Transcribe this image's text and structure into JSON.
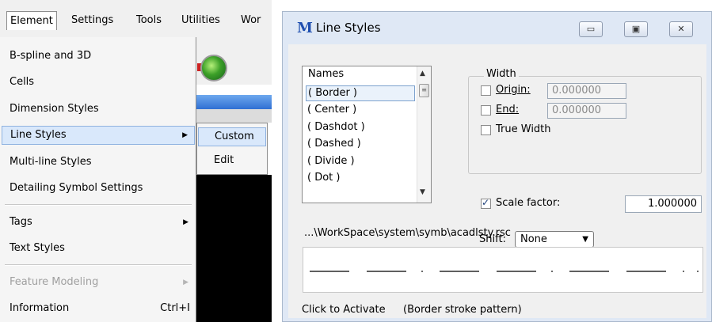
{
  "menubar": {
    "items": [
      {
        "label": "Element",
        "active": true
      },
      {
        "label": "Settings",
        "active": false
      },
      {
        "label": "Tools",
        "active": false
      },
      {
        "label": "Utilities",
        "active": false
      },
      {
        "label": "Wor",
        "active": false
      }
    ]
  },
  "element_menu": {
    "items": [
      {
        "label": "B-spline and 3D"
      },
      {
        "label": "Cells"
      },
      {
        "label": "Dimension Styles"
      },
      {
        "label": "Line Styles",
        "submenu": true,
        "highlighted": true
      },
      {
        "label": "Multi-line Styles"
      },
      {
        "label": "Detailing Symbol Settings"
      },
      {
        "label": "Tags",
        "submenu": true
      },
      {
        "label": "Text Styles"
      },
      {
        "label": "Feature Modeling",
        "submenu": true,
        "disabled": true
      },
      {
        "label": "Information",
        "shortcut": "Ctrl+I"
      }
    ]
  },
  "line_styles_submenu": {
    "items": [
      {
        "label": "Custom",
        "highlighted": true
      },
      {
        "label": "Edit"
      }
    ]
  },
  "dialog": {
    "title": "Line Styles",
    "window_buttons": {
      "minimize": "▭",
      "restore": "▣",
      "close": "✕"
    },
    "names_list": {
      "header": "Names",
      "items": [
        "( Border )",
        "( Center )",
        "( Dashdot )",
        "( Dashed )",
        "( Divide )",
        "( Dot )"
      ],
      "selected_index": 0
    },
    "width": {
      "legend": "Width",
      "origin_label": "Origin:",
      "origin_value": "0.000000",
      "origin_checked": false,
      "end_label": "End:",
      "end_value": "0.000000",
      "end_checked": false,
      "true_width_label": "True Width",
      "true_width_checked": false
    },
    "scale_factor": {
      "label": "Scale factor:",
      "value": "1.000000",
      "checked": true
    },
    "shift": {
      "label": "Shift:",
      "value": "None"
    },
    "file_path": "...\\WorkSpace\\system\\symb\\acadlsty.rsc",
    "status": {
      "label": "Click to Activate",
      "description": "(Border stroke pattern)"
    }
  },
  "colors": {
    "highlight": "#d9e8fb",
    "dialog_frame": "#dfe8f5",
    "accent_blue": "#2f6fd3"
  }
}
